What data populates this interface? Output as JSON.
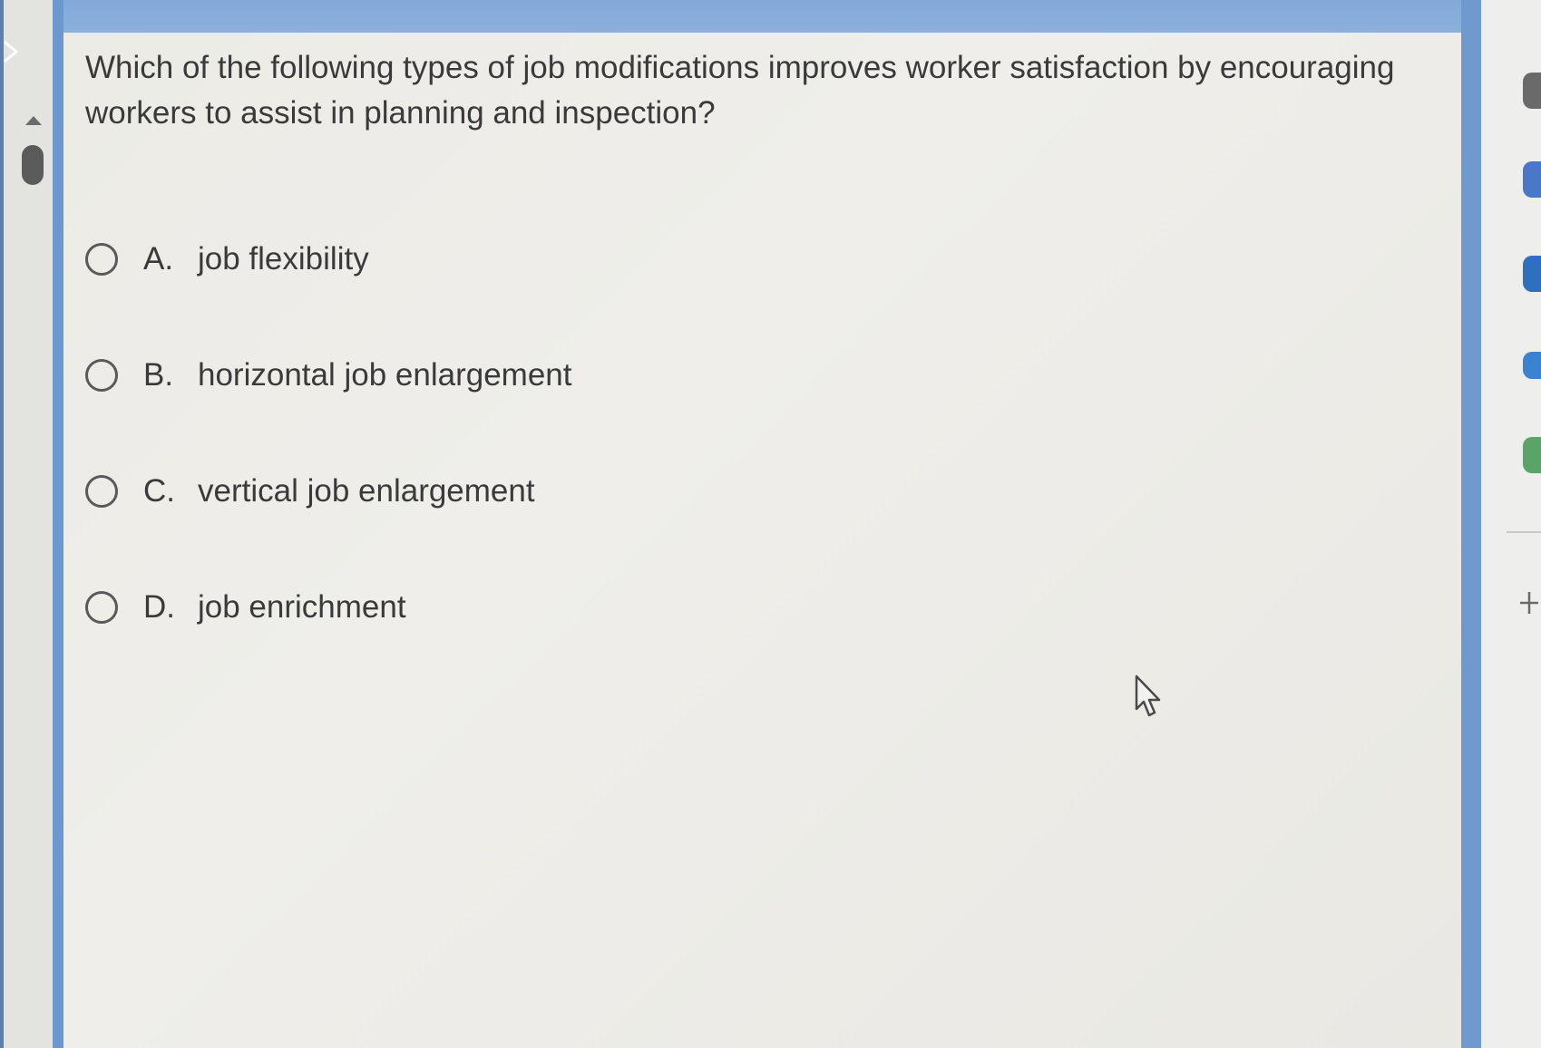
{
  "question": {
    "text": "Which of the following types of job modifications improves worker satisfaction by encouraging workers to assist in planning and inspection?"
  },
  "options": [
    {
      "letter": "A.",
      "text": "job flexibility",
      "selected": false
    },
    {
      "letter": "B.",
      "text": "horizontal job enlargement",
      "selected": false
    },
    {
      "letter": "C.",
      "text": "vertical job enlargement",
      "selected": false
    },
    {
      "letter": "D.",
      "text": "job enrichment",
      "selected": false
    }
  ],
  "icons": {
    "expand": "chevron-right-icon",
    "scroll_up": "triangle-up-icon",
    "cursor": "mouse-pointer-icon",
    "add": "plus-icon"
  },
  "colors": {
    "frame_blue": "#7fa6d6",
    "content_bg": "#eeede9",
    "text": "#3a3a3a",
    "radio_border": "#5a5a5a"
  }
}
